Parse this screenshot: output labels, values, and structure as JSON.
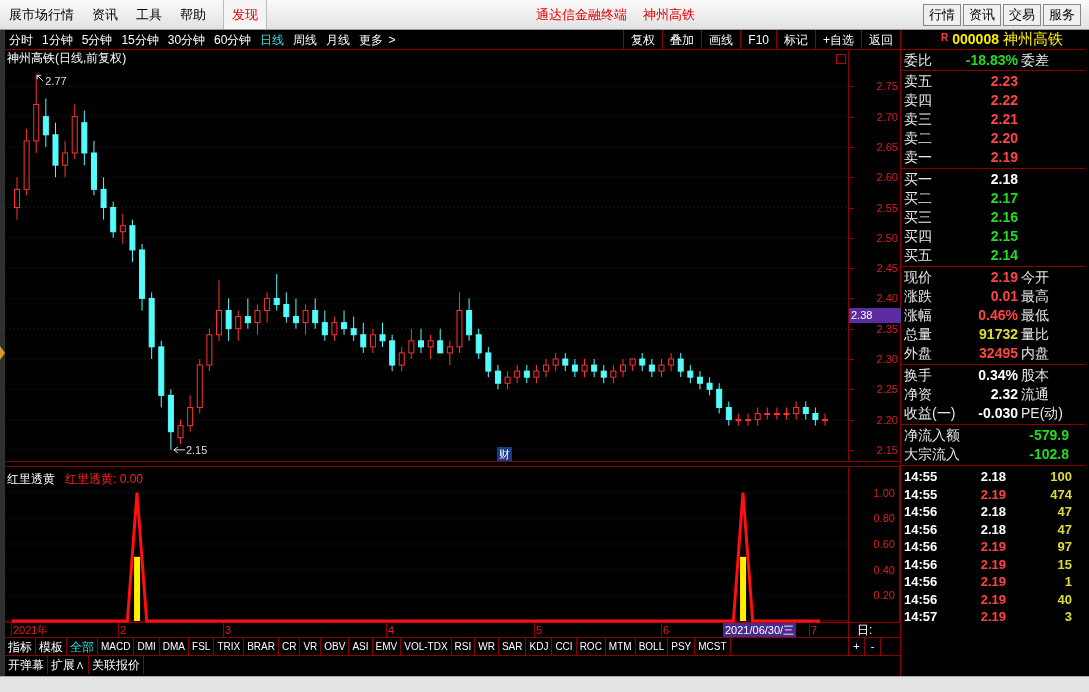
{
  "menu_bar": {
    "items": [
      {
        "label": "展市场行情",
        "highlighted": false
      },
      {
        "label": "资讯",
        "highlighted": false
      },
      {
        "label": "工具",
        "highlighted": false
      },
      {
        "label": "帮助",
        "highlighted": false
      },
      {
        "label": "发现",
        "highlighted": true
      }
    ],
    "title_parts": [
      "通达信金融终端",
      "神州高铁"
    ],
    "buttons": [
      "行情",
      "资讯",
      "交易",
      "服务"
    ]
  },
  "period_tabs": [
    {
      "label": "分时",
      "selected": false
    },
    {
      "label": "1分钟",
      "selected": false
    },
    {
      "label": "5分钟",
      "selected": false
    },
    {
      "label": "15分钟",
      "selected": false
    },
    {
      "label": "30分钟",
      "selected": false
    },
    {
      "label": "60分钟",
      "selected": false
    },
    {
      "label": "日线",
      "selected": true
    },
    {
      "label": "周线",
      "selected": false
    },
    {
      "label": "月线",
      "selected": false
    },
    {
      "label": "更多",
      "selected": false
    }
  ],
  "more_arrow": ">",
  "chart_tools": [
    "复权",
    "叠加",
    "画线",
    "F10",
    "标记",
    "+自选",
    "返回"
  ],
  "stock_header": {
    "badge": "R",
    "code": "000008",
    "name": "神州高铁"
  },
  "price_chart": {
    "title": "神州高铁(日线,前复权)",
    "cursor_price": "2.38",
    "high_label": "2.77",
    "low_label": "2.15",
    "event_marker": "财",
    "chart_data": {
      "type": "candlestick",
      "grid": true,
      "ylim": [
        2.13,
        2.81
      ],
      "yticks": [
        {
          "value": 2.75,
          "label": "2.75"
        },
        {
          "value": 2.7,
          "label": "2.70"
        },
        {
          "value": 2.65,
          "label": "2.65"
        },
        {
          "value": 2.6,
          "label": "2.60"
        },
        {
          "value": 2.55,
          "label": "2.55"
        },
        {
          "value": 2.5,
          "label": "2.50"
        },
        {
          "value": 2.45,
          "label": "2.45"
        },
        {
          "value": 2.4,
          "label": "2.40"
        },
        {
          "value": 2.35,
          "label": "2.35"
        },
        {
          "value": 2.3,
          "label": "2.30"
        },
        {
          "value": 2.25,
          "label": "2.25"
        },
        {
          "value": 2.2,
          "label": "2.20"
        },
        {
          "value": 2.15,
          "label": "2.15"
        }
      ],
      "ohlc": [
        [
          2.55,
          2.6,
          2.53,
          2.58
        ],
        [
          2.58,
          2.68,
          2.57,
          2.66
        ],
        [
          2.66,
          2.77,
          2.64,
          2.72
        ],
        [
          2.7,
          2.73,
          2.65,
          2.67
        ],
        [
          2.67,
          2.69,
          2.6,
          2.62
        ],
        [
          2.62,
          2.66,
          2.6,
          2.64
        ],
        [
          2.64,
          2.72,
          2.63,
          2.7
        ],
        [
          2.69,
          2.71,
          2.62,
          2.64
        ],
        [
          2.64,
          2.66,
          2.57,
          2.58
        ],
        [
          2.58,
          2.6,
          2.53,
          2.55
        ],
        [
          2.55,
          2.56,
          2.5,
          2.51
        ],
        [
          2.51,
          2.54,
          2.49,
          2.52
        ],
        [
          2.52,
          2.53,
          2.46,
          2.48
        ],
        [
          2.48,
          2.49,
          2.38,
          2.4
        ],
        [
          2.4,
          2.41,
          2.3,
          2.32
        ],
        [
          2.32,
          2.33,
          2.22,
          2.24
        ],
        [
          2.24,
          2.25,
          2.15,
          2.18
        ],
        [
          2.17,
          2.2,
          2.16,
          2.19
        ],
        [
          2.19,
          2.24,
          2.18,
          2.22
        ],
        [
          2.22,
          2.3,
          2.21,
          2.29
        ],
        [
          2.29,
          2.35,
          2.28,
          2.34
        ],
        [
          2.34,
          2.43,
          2.33,
          2.38
        ],
        [
          2.38,
          2.4,
          2.33,
          2.35
        ],
        [
          2.35,
          2.38,
          2.33,
          2.37
        ],
        [
          2.37,
          2.4,
          2.35,
          2.36
        ],
        [
          2.36,
          2.39,
          2.34,
          2.38
        ],
        [
          2.38,
          2.41,
          2.36,
          2.4
        ],
        [
          2.4,
          2.44,
          2.38,
          2.39
        ],
        [
          2.39,
          2.41,
          2.36,
          2.37
        ],
        [
          2.37,
          2.4,
          2.35,
          2.36
        ],
        [
          2.36,
          2.39,
          2.34,
          2.38
        ],
        [
          2.38,
          2.4,
          2.35,
          2.36
        ],
        [
          2.36,
          2.38,
          2.33,
          2.34
        ],
        [
          2.34,
          2.37,
          2.33,
          2.36
        ],
        [
          2.36,
          2.38,
          2.34,
          2.35
        ],
        [
          2.35,
          2.37,
          2.33,
          2.34
        ],
        [
          2.34,
          2.36,
          2.31,
          2.32
        ],
        [
          2.32,
          2.35,
          2.31,
          2.34
        ],
        [
          2.34,
          2.36,
          2.32,
          2.33
        ],
        [
          2.33,
          2.34,
          2.28,
          2.29
        ],
        [
          2.29,
          2.32,
          2.28,
          2.31
        ],
        [
          2.31,
          2.35,
          2.3,
          2.33
        ],
        [
          2.33,
          2.35,
          2.31,
          2.32
        ],
        [
          2.32,
          2.34,
          2.3,
          2.33
        ],
        [
          2.33,
          2.35,
          2.31,
          2.31
        ],
        [
          2.31,
          2.33,
          2.29,
          2.32
        ],
        [
          2.32,
          2.41,
          2.31,
          2.38
        ],
        [
          2.38,
          2.4,
          2.33,
          2.34
        ],
        [
          2.34,
          2.35,
          2.3,
          2.31
        ],
        [
          2.31,
          2.32,
          2.27,
          2.28
        ],
        [
          2.28,
          2.29,
          2.25,
          2.26
        ],
        [
          2.26,
          2.28,
          2.25,
          2.27
        ],
        [
          2.27,
          2.29,
          2.26,
          2.28
        ],
        [
          2.28,
          2.29,
          2.26,
          2.27
        ],
        [
          2.27,
          2.29,
          2.26,
          2.28
        ],
        [
          2.28,
          2.3,
          2.27,
          2.29
        ],
        [
          2.29,
          2.31,
          2.28,
          2.3
        ],
        [
          2.3,
          2.31,
          2.28,
          2.29
        ],
        [
          2.29,
          2.3,
          2.27,
          2.28
        ],
        [
          2.28,
          2.3,
          2.27,
          2.29
        ],
        [
          2.29,
          2.3,
          2.27,
          2.28
        ],
        [
          2.28,
          2.29,
          2.26,
          2.27
        ],
        [
          2.27,
          2.29,
          2.26,
          2.28
        ],
        [
          2.28,
          2.3,
          2.27,
          2.29
        ],
        [
          2.29,
          2.3,
          2.28,
          2.3
        ],
        [
          2.3,
          2.31,
          2.28,
          2.29
        ],
        [
          2.29,
          2.3,
          2.27,
          2.28
        ],
        [
          2.28,
          2.3,
          2.27,
          2.29
        ],
        [
          2.29,
          2.31,
          2.28,
          2.3
        ],
        [
          2.3,
          2.31,
          2.27,
          2.28
        ],
        [
          2.28,
          2.29,
          2.26,
          2.27
        ],
        [
          2.27,
          2.28,
          2.25,
          2.26
        ],
        [
          2.26,
          2.27,
          2.24,
          2.25
        ],
        [
          2.25,
          2.26,
          2.21,
          2.22
        ],
        [
          2.22,
          2.23,
          2.19,
          2.2
        ],
        [
          2.2,
          2.21,
          2.19,
          2.2
        ],
        [
          2.2,
          2.21,
          2.19,
          2.2
        ],
        [
          2.2,
          2.22,
          2.19,
          2.21
        ],
        [
          2.21,
          2.22,
          2.2,
          2.21
        ],
        [
          2.21,
          2.22,
          2.2,
          2.21
        ],
        [
          2.21,
          2.22,
          2.2,
          2.21
        ],
        [
          2.21,
          2.23,
          2.2,
          2.22
        ],
        [
          2.22,
          2.23,
          2.2,
          2.21
        ],
        [
          2.21,
          2.22,
          2.19,
          2.2
        ],
        [
          2.2,
          2.21,
          2.19,
          2.2
        ]
      ]
    }
  },
  "indicator": {
    "value_label": "红里透黄: 0.00",
    "chart_data": {
      "type": "line",
      "grid": true,
      "ylim": [
        0,
        1.2
      ],
      "yticks": [
        {
          "value": 1,
          "label": "1.00"
        },
        {
          "value": 0.8,
          "label": "0.80"
        },
        {
          "value": 0.6,
          "label": "0.60"
        },
        {
          "value": 0.4,
          "label": "0.40"
        },
        {
          "value": 0.2,
          "label": "0.20"
        }
      ],
      "series": [
        {
          "name": "红里透黄",
          "color": "#ff1010",
          "values": [
            0,
            0,
            0,
            0,
            0,
            0,
            0,
            0,
            0,
            0,
            0,
            0,
            0,
            1,
            0,
            0,
            0,
            0,
            0,
            0,
            0,
            0,
            0,
            0,
            0,
            0,
            0,
            0,
            0,
            0,
            0,
            0,
            0,
            0,
            0,
            0,
            0,
            0,
            0,
            0,
            0,
            0,
            0,
            0,
            0,
            0,
            0,
            0,
            0,
            0,
            0,
            0,
            0,
            0,
            0,
            0,
            0,
            0,
            0,
            0,
            0,
            0,
            0,
            0,
            0,
            0,
            0,
            0,
            0,
            0,
            0,
            0,
            0,
            0,
            0,
            0,
            1,
            0,
            0,
            0,
            0,
            0,
            0,
            0,
            0
          ]
        },
        {
          "type": "bar",
          "color": "#ffee00",
          "values": [
            null,
            null,
            null,
            null,
            null,
            null,
            null,
            null,
            null,
            null,
            null,
            null,
            null,
            0.5,
            null,
            null,
            null,
            null,
            null,
            null,
            null,
            null,
            null,
            null,
            null,
            null,
            null,
            null,
            null,
            null,
            null,
            null,
            null,
            null,
            null,
            null,
            null,
            null,
            null,
            null,
            null,
            null,
            null,
            null,
            null,
            null,
            null,
            null,
            null,
            null,
            null,
            null,
            null,
            null,
            null,
            null,
            null,
            null,
            null,
            null,
            null,
            null,
            null,
            null,
            null,
            null,
            null,
            null,
            null,
            null,
            null,
            null,
            null,
            null,
            null,
            null,
            0.5,
            null,
            null,
            null,
            null,
            null,
            null,
            null,
            null
          ]
        }
      ]
    }
  },
  "date_axis": {
    "labels": [
      "2021年",
      "2",
      "3",
      "4",
      "5",
      "6",
      "7"
    ],
    "cursor_date": "2021/06/30/三",
    "period_label": "日:",
    "zoom_buttons": [
      "+",
      "-"
    ]
  },
  "indicator_tabs": [
    {
      "label": "指标",
      "selected": false
    },
    {
      "label": "模板",
      "selected": false
    },
    {
      "label": "全部",
      "selected": true
    },
    {
      "label": "MACD",
      "selected": false
    },
    {
      "label": "DMI",
      "selected": false
    },
    {
      "label": "DMA",
      "selected": false
    },
    {
      "label": "FSL",
      "selected": false
    },
    {
      "label": "TRIX",
      "selected": false
    },
    {
      "label": "BRAR",
      "selected": false
    },
    {
      "label": "CR",
      "selected": false
    },
    {
      "label": "VR",
      "selected": false
    },
    {
      "label": "OBV",
      "selected": false
    },
    {
      "label": "ASI",
      "selected": false
    },
    {
      "label": "EMV",
      "selected": false
    },
    {
      "label": "VOL-TDX",
      "selected": false
    },
    {
      "label": "RSI",
      "selected": false
    },
    {
      "label": "WR",
      "selected": false
    },
    {
      "label": "SAR",
      "selected": false
    },
    {
      "label": "KDJ",
      "selected": false
    },
    {
      "label": "CCI",
      "selected": false
    },
    {
      "label": "ROC",
      "selected": false
    },
    {
      "label": "MTM",
      "selected": false
    },
    {
      "label": "BOLL",
      "selected": false
    },
    {
      "label": "PSY",
      "selected": false
    },
    {
      "label": "MCST",
      "selected": false
    }
  ],
  "bottom_buttons": [
    "开弹幕",
    "扩展∧",
    "关联报价"
  ],
  "quote_panel": {
    "order_ratio": {
      "label": "委比",
      "value": "-18.83%",
      "color": "#22dd22",
      "right_label": "委差"
    },
    "sections": [
      [
        {
          "label": "卖五",
          "value": "2.23",
          "color": "#ff4444"
        },
        {
          "label": "卖四",
          "value": "2.22",
          "color": "#ff4444"
        },
        {
          "label": "卖三",
          "value": "2.21",
          "color": "#ff4444"
        },
        {
          "label": "卖二",
          "value": "2.20",
          "color": "#ff4444"
        },
        {
          "label": "卖一",
          "value": "2.19",
          "color": "#ff4444"
        }
      ],
      [
        {
          "label": "买一",
          "value": "2.18",
          "color": "#ffffff"
        },
        {
          "label": "买二",
          "value": "2.17",
          "color": "#22dd22"
        },
        {
          "label": "买三",
          "value": "2.16",
          "color": "#22dd22"
        },
        {
          "label": "买四",
          "value": "2.15",
          "color": "#22dd22"
        },
        {
          "label": "买五",
          "value": "2.14",
          "color": "#22dd22"
        }
      ],
      [
        {
          "label": "现价",
          "value": "2.19",
          "color": "#ff4444",
          "right_label": "今开"
        },
        {
          "label": "涨跌",
          "value": "0.01",
          "color": "#ff4444",
          "right_label": "最高"
        },
        {
          "label": "涨幅",
          "value": "0.46%",
          "color": "#ff4444",
          "right_label": "最低"
        },
        {
          "label": "总量",
          "value": "91732",
          "color": "#dddd33",
          "right_label": "量比"
        },
        {
          "label": "外盘",
          "value": "32495",
          "color": "#ff4444",
          "right_label": "内盘"
        }
      ],
      [
        {
          "label": "换手",
          "value": "0.34%",
          "color": "#ffffff",
          "right_label": "股本"
        },
        {
          "label": "净资",
          "value": "2.32",
          "color": "#ffffff",
          "right_label": "流通"
        },
        {
          "label": "收益(一)",
          "value": "-0.030",
          "color": "#ffffff",
          "right_label": "PE(动)"
        }
      ],
      [
        {
          "label": "净流入额",
          "value": "-579.9",
          "color": "#22dd22"
        },
        {
          "label": "大宗流入",
          "value": "-102.8",
          "color": "#22dd22"
        }
      ]
    ]
  },
  "ticks": [
    {
      "time": "14:55",
      "price": "2.18",
      "color": "#ffffff",
      "volume": "100"
    },
    {
      "time": "14:55",
      "price": "2.19",
      "color": "#ff4444",
      "volume": "474"
    },
    {
      "time": "14:56",
      "price": "2.18",
      "color": "#ffffff",
      "volume": "47"
    },
    {
      "time": "14:56",
      "price": "2.18",
      "color": "#ffffff",
      "volume": "47"
    },
    {
      "time": "14:56",
      "price": "2.19",
      "color": "#ff4444",
      "volume": "97"
    },
    {
      "time": "14:56",
      "price": "2.19",
      "color": "#ff4444",
      "volume": "15"
    },
    {
      "time": "14:56",
      "price": "2.19",
      "color": "#ff4444",
      "volume": "1"
    },
    {
      "time": "14:56",
      "price": "2.19",
      "color": "#ff4444",
      "volume": "40"
    },
    {
      "time": "14:57",
      "price": "2.19",
      "color": "#ff4444",
      "volume": "3"
    }
  ]
}
